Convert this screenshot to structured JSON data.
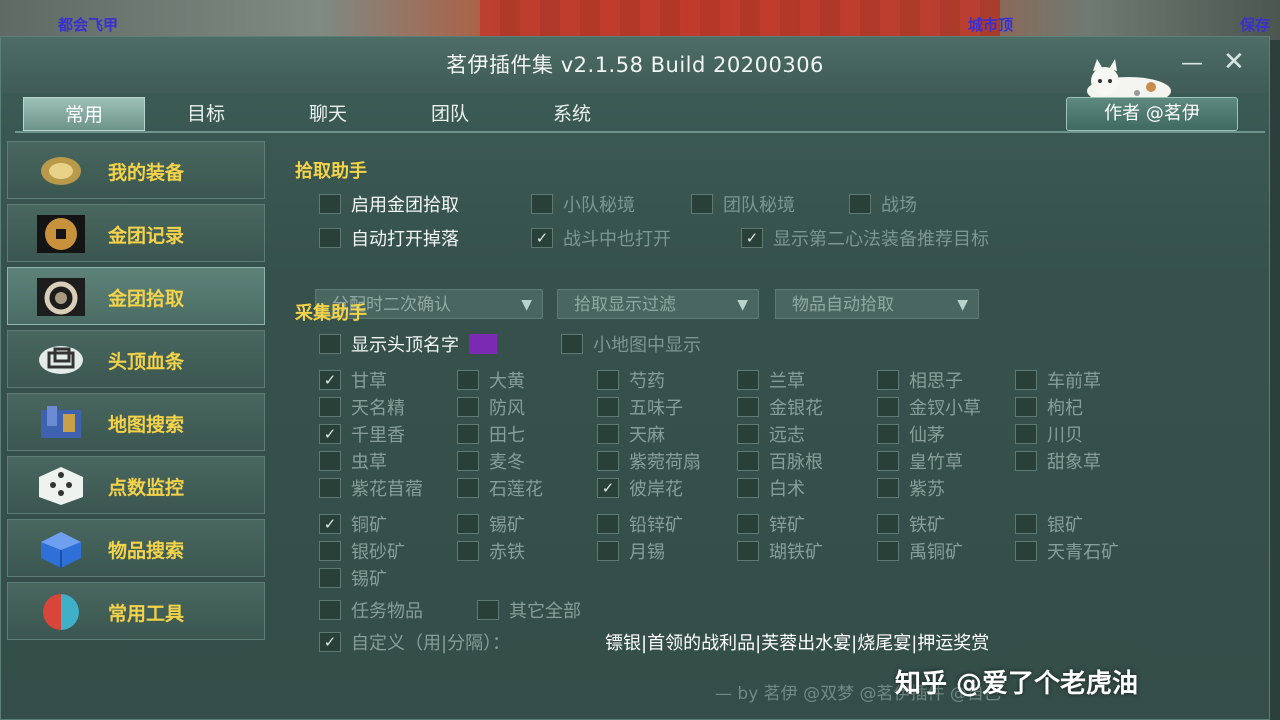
{
  "background": {
    "npc_left": "都会飞甲",
    "npc_right": "城市顶",
    "npc_right2": "保存"
  },
  "window": {
    "title": "茗伊插件集 v2.1.58 Build 20200306",
    "minimize_icon": "minimize-icon",
    "close_icon": "close-icon",
    "author_button": "作者 @茗伊"
  },
  "tabs": [
    {
      "label": "常用",
      "active": true
    },
    {
      "label": "目标",
      "active": false
    },
    {
      "label": "聊天",
      "active": false
    },
    {
      "label": "团队",
      "active": false
    },
    {
      "label": "系统",
      "active": false
    }
  ],
  "sidebar": {
    "items": [
      {
        "label": "我的装备",
        "icon": "equipment-icon",
        "active": false
      },
      {
        "label": "金团记录",
        "icon": "gold-coin-icon",
        "active": false
      },
      {
        "label": "金团拾取",
        "icon": "loot-bag-icon",
        "active": true
      },
      {
        "label": "头顶血条",
        "icon": "health-bar-icon",
        "active": false
      },
      {
        "label": "地图搜索",
        "icon": "map-search-icon",
        "active": false
      },
      {
        "label": "点数监控",
        "icon": "dice-icon",
        "active": false
      },
      {
        "label": "物品搜索",
        "icon": "item-box-icon",
        "active": false
      },
      {
        "label": "常用工具",
        "icon": "tools-icon",
        "active": false
      }
    ]
  },
  "loot": {
    "section_title": "拾取助手",
    "row1": [
      {
        "label": "启用金团拾取",
        "checked": false,
        "state": "on"
      },
      {
        "label": "小队秘境",
        "checked": false,
        "state": "off"
      },
      {
        "label": "团队秘境",
        "checked": false,
        "state": "off"
      },
      {
        "label": "战场",
        "checked": false,
        "state": "off"
      }
    ],
    "row2": [
      {
        "label": "自动打开掉落",
        "checked": false,
        "state": "on"
      },
      {
        "label": "战斗中也打开",
        "checked": true,
        "state": "off"
      },
      {
        "label": "显示第二心法装备推荐目标",
        "checked": true,
        "state": "off"
      }
    ],
    "dropdowns": [
      {
        "label": "分配时二次确认"
      },
      {
        "label": "拾取显示过滤"
      },
      {
        "label": "物品自动拾取"
      }
    ]
  },
  "gather": {
    "section_title": "采集助手",
    "top": [
      {
        "label": "显示头顶名字",
        "checked": false,
        "state": "on",
        "swatch": "#7b2bb3"
      },
      {
        "label": "小地图中显示",
        "checked": false,
        "state": "off"
      }
    ],
    "herbs": [
      {
        "label": "甘草",
        "checked": true
      },
      {
        "label": "大黄",
        "checked": false
      },
      {
        "label": "芍药",
        "checked": false
      },
      {
        "label": "兰草",
        "checked": false
      },
      {
        "label": "相思子",
        "checked": false
      },
      {
        "label": "车前草",
        "checked": false
      },
      {
        "label": "天名精",
        "checked": false
      },
      {
        "label": "防风",
        "checked": false
      },
      {
        "label": "五味子",
        "checked": false
      },
      {
        "label": "金银花",
        "checked": false
      },
      {
        "label": "金钗小草",
        "checked": false
      },
      {
        "label": "枸杞",
        "checked": false
      },
      {
        "label": "千里香",
        "checked": true
      },
      {
        "label": "田七",
        "checked": false
      },
      {
        "label": "天麻",
        "checked": false
      },
      {
        "label": "远志",
        "checked": false
      },
      {
        "label": "仙茅",
        "checked": false
      },
      {
        "label": "川贝",
        "checked": false
      },
      {
        "label": "虫草",
        "checked": false
      },
      {
        "label": "麦冬",
        "checked": false
      },
      {
        "label": "紫菀荷扇",
        "checked": false
      },
      {
        "label": "百脉根",
        "checked": false
      },
      {
        "label": "皇竹草",
        "checked": false
      },
      {
        "label": "甜象草",
        "checked": false
      },
      {
        "label": "紫花苜蓿",
        "checked": false
      },
      {
        "label": "石莲花",
        "checked": false
      },
      {
        "label": "彼岸花",
        "checked": true
      },
      {
        "label": "白术",
        "checked": false
      },
      {
        "label": "紫苏",
        "checked": false
      }
    ],
    "ores": [
      {
        "label": "铜矿",
        "checked": true
      },
      {
        "label": "锡矿",
        "checked": false
      },
      {
        "label": "铅锌矿",
        "checked": false
      },
      {
        "label": "锌矿",
        "checked": false
      },
      {
        "label": "铁矿",
        "checked": false
      },
      {
        "label": "银矿",
        "checked": false
      },
      {
        "label": "银砂矿",
        "checked": false
      },
      {
        "label": "赤铁",
        "checked": false
      },
      {
        "label": "月锡",
        "checked": false
      },
      {
        "label": "瑚铁矿",
        "checked": false
      },
      {
        "label": "禹铜矿",
        "checked": false
      },
      {
        "label": "天青石矿",
        "checked": false
      },
      {
        "label": "锡矿",
        "checked": false
      }
    ],
    "other": [
      {
        "label": "任务物品",
        "checked": false
      },
      {
        "label": "其它全部",
        "checked": false
      }
    ],
    "custom": {
      "label": "自定义（用|分隔）：",
      "checked": true,
      "value": "镖银|首领的战利品|芙蓉出水宴|烧尾宴|押运奖赏"
    }
  },
  "watermark": {
    "by": "— by 茗伊 @双梦 @茗伊插件 @自己",
    "zhihu": "知乎 @爱了个老虎油"
  }
}
